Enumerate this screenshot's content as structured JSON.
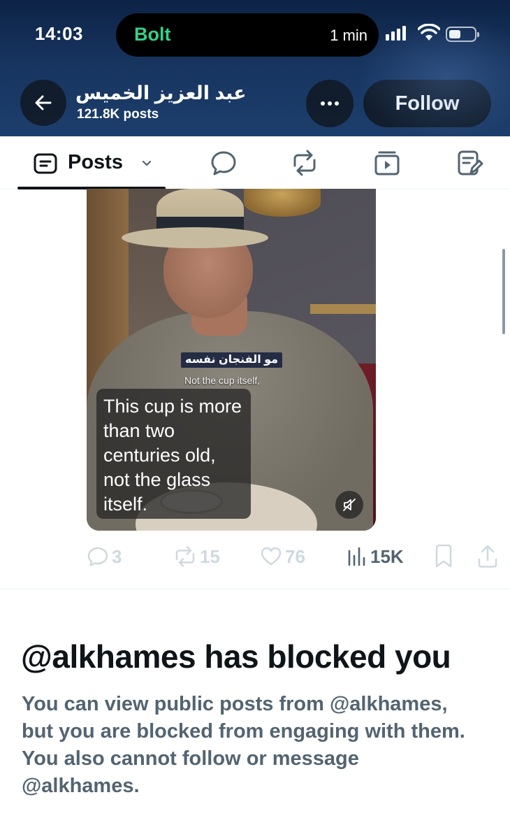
{
  "status_bar": {
    "time": "14:03",
    "live_activity_app": "Bolt",
    "live_activity_eta": "1 min"
  },
  "profile_header": {
    "name": "عبد العزيز الخميس",
    "post_count": "121.8K posts",
    "follow_label": "Follow"
  },
  "tabs": {
    "posts_label": "Posts"
  },
  "video": {
    "subtitle_arabic": "مو الفنجان نفسه",
    "subtitle_english": "Not the cup itself,",
    "caption": "This cup is more than two centuries old, not the glass itself."
  },
  "post_actions": {
    "replies": "3",
    "reposts": "15",
    "likes": "76",
    "views": "15K"
  },
  "blocked_notice": {
    "title": "@alkhames has blocked you",
    "description": "You can view public posts from @alkhames, but you are blocked from engaging with them. You also cannot follow or message @alkhames."
  },
  "colors": {
    "primary_text": "#0f1419",
    "secondary_text": "#536471",
    "muted_icon": "#cfd9de",
    "bolt_green": "#34d186",
    "header_navy": "#17345f"
  },
  "icons": {
    "back": "arrow-left-icon",
    "more": "more-dots-icon",
    "tab_posts": "posts-icon",
    "tab_replies": "speech-bubble-icon",
    "tab_reposts": "repost-icon",
    "tab_videos": "video-icon",
    "tab_articles": "article-icon",
    "mute": "muted-speaker-icon",
    "reply": "reply-icon",
    "repost": "repost-icon",
    "like": "heart-icon",
    "views": "views-bar-icon",
    "bookmark": "bookmark-icon",
    "share": "share-icon"
  }
}
